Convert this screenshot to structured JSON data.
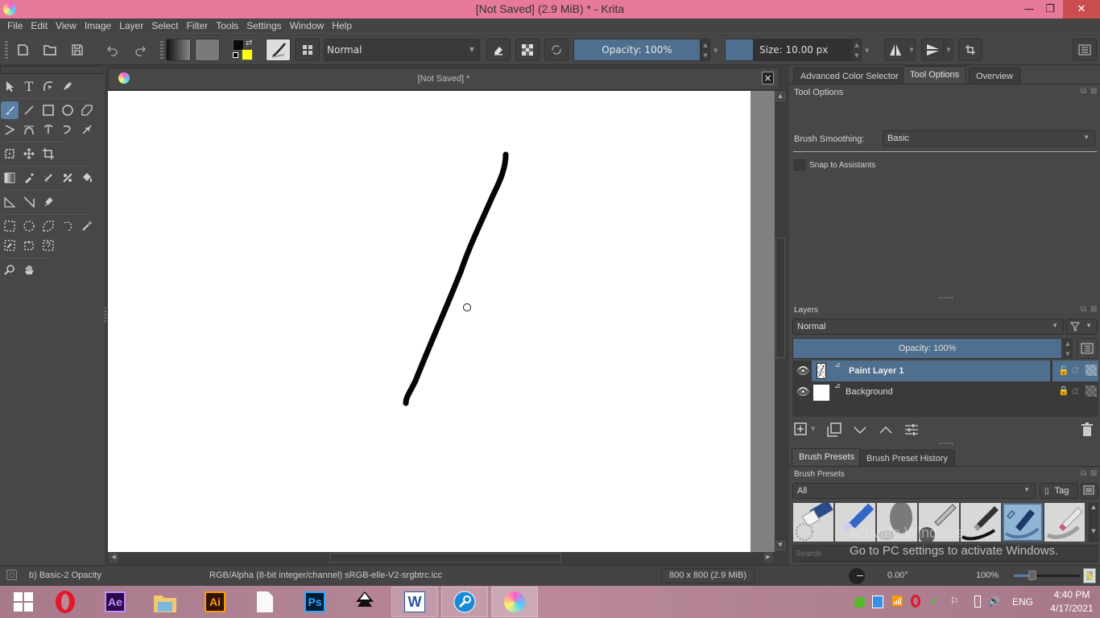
{
  "window": {
    "title": "[Not Saved]  (2.9 MiB)  * - Krita",
    "minimize": "—",
    "maximize": "❐",
    "close": "✕"
  },
  "menu": [
    "File",
    "Edit",
    "View",
    "Image",
    "Layer",
    "Select",
    "Filter",
    "Tools",
    "Settings",
    "Window",
    "Help"
  ],
  "toolbar": {
    "blend_mode": "Normal",
    "opacity": "Opacity: 100%",
    "size": "Size: 10.00 px",
    "colors": {
      "foreground": "#000000",
      "background": "#ffff00"
    }
  },
  "document": {
    "tab_title": "[Not Saved]  *",
    "close": "×"
  },
  "docker": {
    "tabs": [
      "Advanced Color Selector",
      "Tool Options",
      "Overview"
    ],
    "active_tab": "Tool Options",
    "tool_options": {
      "title": "Tool Options",
      "brush_smoothing_label": "Brush Smoothing:",
      "brush_smoothing_value": "Basic",
      "snap_label": "Snap to Assistants",
      "snap_checked": false
    },
    "layers": {
      "title": "Layers",
      "blend_mode": "Normal",
      "opacity": "Opacity:  100%",
      "items": [
        {
          "name": "Paint Layer 1",
          "selected": true,
          "visible": true,
          "locked": false
        },
        {
          "name": "Background",
          "selected": false,
          "visible": true,
          "locked": true
        }
      ]
    },
    "brush_tabs": [
      "Brush Presets",
      "Brush Preset History"
    ],
    "brush_presets": {
      "title": "Brush Presets",
      "filter": "All",
      "tag": "Tag",
      "search_placeholder": "Search",
      "presets": [
        "eraser",
        "blue-eraser",
        "airbrush",
        "ink-pen",
        "marker",
        "basic-2-opacity",
        "pencil"
      ],
      "selected": "basic-2-opacity"
    },
    "watermark": {
      "line1": "Activate Windows",
      "line2": "Go to PC settings to activate Windows."
    }
  },
  "status": {
    "brush": "b) Basic-2 Opacity",
    "color_space": "RGB/Alpha (8-bit integer/channel)  sRGB-elle-V2-srgbtrc.icc",
    "dimensions": "800 x 800 (2.9 MiB)",
    "rotation": "0.00°",
    "zoom": "100%"
  },
  "taskbar": {
    "apps": [
      "Start",
      "Opera",
      "After Effects",
      "File Explorer",
      "Illustrator",
      "Document",
      "Photoshop",
      "Inkscape",
      "Word",
      "Settings Tool",
      "Krita"
    ],
    "language": "ENG",
    "time": "4:40 PM",
    "date": "4/17/2021"
  }
}
